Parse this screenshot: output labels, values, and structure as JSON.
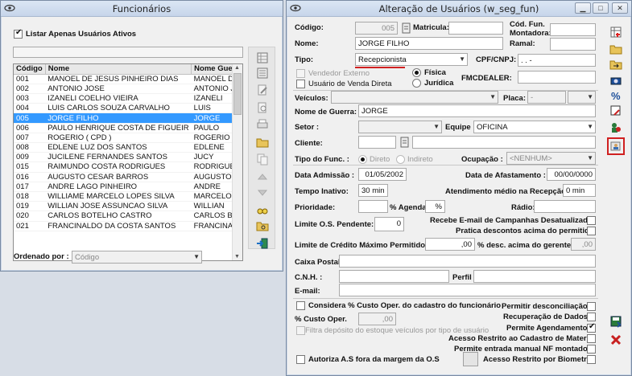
{
  "left_window": {
    "title": "Funcionários",
    "only_active_label": "Listar Apenas Usuários Ativos",
    "only_active_checked": true,
    "columns": [
      "Código",
      "Nome",
      "Nome Guerra"
    ],
    "rows": [
      [
        "001",
        "MANOEL DE JESUS PINHEIRO DIAS",
        "MANOEL DIAS"
      ],
      [
        "002",
        "ANTONIO JOSE",
        "ANTONIO JOSE"
      ],
      [
        "003",
        "IZANELI COELHO VIEIRA",
        "IZANELI"
      ],
      [
        "004",
        "LUIS CARLOS SOUZA CARVALHO",
        "LUIS"
      ],
      [
        "005",
        "JORGE FILHO",
        "JORGE"
      ],
      [
        "006",
        "PAULO HENRIQUE COSTA DE FIGUEIR",
        "PAULO"
      ],
      [
        "007",
        "ROGERIO ( CPD )",
        "ROGERIO"
      ],
      [
        "008",
        "EDLENE LUZ DOS SANTOS",
        "EDLENE"
      ],
      [
        "009",
        "JUCILENE FERNANDES SANTOS",
        "JUCY"
      ],
      [
        "015",
        "RAIMUNDO COSTA RODRIGUES",
        "RODRIGUES"
      ],
      [
        "016",
        "AUGUSTO CESAR BARROS",
        "AUGUSTO"
      ],
      [
        "017",
        "ANDRE LAGO PINHEIRO",
        "ANDRE"
      ],
      [
        "018",
        "WILLIAME MARCELO LOPES SILVA",
        "MARCELO"
      ],
      [
        "019",
        "WILLIAN JOSE ASSUNCAO SILVA",
        "WILLIAN"
      ],
      [
        "020",
        "CARLOS BOTELHO CASTRO",
        "CARLOS BOTEL"
      ],
      [
        "021",
        "FRANCINALDO DA COSTA SANTOS",
        "FRANCINALDO"
      ]
    ],
    "selected_row": 4,
    "order_label": "Ordenado por :",
    "order_value": "Código"
  },
  "right_window": {
    "title": "Alteração de Usuários (w_seg_fun)",
    "codigo_label": "Código:",
    "codigo_value": "005",
    "matricula_label": "Matricula:",
    "cod_fun_label": "Cód. Fun.",
    "montadora_label": "Montadora:",
    "nome_label": "Nome:",
    "nome_value": "JORGE FILHO",
    "ramal_label": "Ramal:",
    "tipo_label": "Tipo:",
    "tipo_value": "Recepcionista",
    "cpf_label": "CPF/CNPJ:",
    "cpf_value": ". . -",
    "vendedor_externo_label": "Vendedor Externo",
    "venda_direta_label": "Usuário de Venda Direta",
    "fisica_label": "Física",
    "juridica_label": "Jurídica",
    "fmcdealer_label": "FMCDEALER:",
    "veiculos_label": "Veículos:",
    "placa_label": "Placa:",
    "placa_value": "-",
    "nome_guerra_label": "Nome de Guerra:",
    "nome_guerra_value": "JORGE",
    "setor_label": "Setor :",
    "equipe_label": "Equipe :",
    "equipe_value": "OFICINA",
    "cliente_label": "Cliente:",
    "tipo_func_label": "Tipo do Func. :",
    "direto_label": "Direto",
    "indireto_label": "Indireto",
    "ocupacao_label": "Ocupação :",
    "ocupacao_value": "<NENHUM>",
    "data_admissao_label": "Data Admissão :",
    "data_admissao_value": "01/05/2002",
    "data_afastamento_label": "Data de Afastamento :",
    "data_afastamento_value": "00/00/0000",
    "tempo_inativo_label": "Tempo Inativo:",
    "tempo_inativo_value": "30 min",
    "atendimento_label": "Atendimento médio na Recepção :",
    "atendimento_value": "0 min",
    "prioridade_label": "Prioridade:",
    "pct_agenda_label": "% Agenda:",
    "pct_agenda_value": "%",
    "radio_label": "Rádio:",
    "limite_os_label": "Limite O.S. Pendente:",
    "limite_os_value": "0",
    "recebe_email_label": "Recebe E-mail de Campanhas Desatualizadas",
    "pratica_descontos_label": "Pratica descontos acima do permitido",
    "limite_credito_label": "Limite de Crédito Máximo Permitido :",
    "limite_credito_value": ",00",
    "pct_desc_label": "% desc. acima do gerente:",
    "pct_desc_value": ",00",
    "caixa_postal_label": "Caixa Postal:",
    "cnh_label": "C.N.H. :",
    "perfil_label": "Perfil :",
    "email_label": "E-mail:",
    "considera_label": "Considera % Custo Oper. do cadastro do funcionário",
    "pct_custo_label": "% Custo Oper.",
    "pct_custo_value": ",00",
    "filtra_label": "Filtra depósito do estoque veículos por tipo de usuário",
    "permitir_desconciliacao_label": "Permitir desconciliação",
    "recuperacao_label": "Recuperação de Dados",
    "permite_agendamento_label": "Permite Agendamento",
    "permite_agendamento_checked": true,
    "acesso_restrito_label": "Acesso Restrito ao Cadastro de Material",
    "permite_nf_label": "Permite entrada manual NF montadora",
    "autoriza_label": "Autoriza A.S fora da margem da O.S",
    "acesso_biometria_label": "Acesso Restrito por Biometria"
  },
  "accent_selection": "#3399ff",
  "highlight_border": "#d02020"
}
